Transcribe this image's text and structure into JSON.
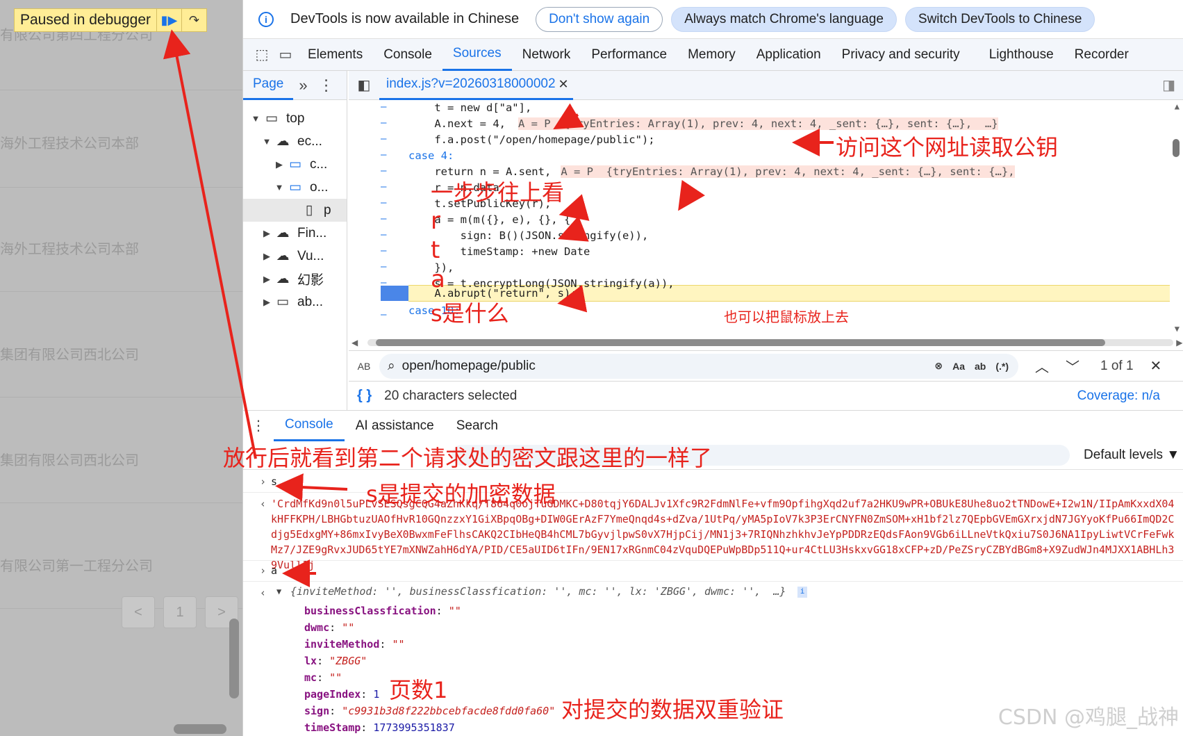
{
  "page": {
    "rows": [
      "有限公司第四工程分公司",
      "海外工程技术公司本部",
      "海外工程技术公司本部",
      "集团有限公司西北公司",
      "集团有限公司西北公司",
      "有限公司第一工程分公司"
    ],
    "pager": [
      "<",
      "1",
      ">"
    ]
  },
  "paused": {
    "label": "Paused in debugger"
  },
  "infobar": {
    "message": "DevTools is now available in Chinese",
    "btn_dont_show": "Don't show again",
    "btn_match": "Always match Chrome's language",
    "btn_switch": "Switch DevTools to Chinese"
  },
  "tabs": [
    "Elements",
    "Console",
    "Sources",
    "Network",
    "Performance",
    "Memory",
    "Application",
    "Privacy and security",
    "Lighthouse",
    "Recorder"
  ],
  "navigator": {
    "tab": "Page",
    "items": [
      {
        "label": "top"
      },
      {
        "label": "ec..."
      },
      {
        "label": "c..."
      },
      {
        "label": "o..."
      },
      {
        "label": "p"
      },
      {
        "label": "Fin..."
      },
      {
        "label": "Vu..."
      },
      {
        "label": "幻影"
      },
      {
        "label": "ab..."
      }
    ]
  },
  "editor": {
    "file_tab": "index.js?v=20260318000002",
    "find_query": "open/homepage/public",
    "find_opts": [
      "Aa",
      "ab",
      "(.*)"
    ],
    "find_count": "1 of 1",
    "status_selected": "20 characters selected",
    "coverage": "Coverage: n/a"
  },
  "code_lines": [
    {
      "text": "    t = new d[\"a\"],"
    },
    {
      "text": "    A.next = 4,"
    },
    {
      "text": "    f.a.post(\"/open/homepage/public\");"
    },
    {
      "text": "case 4:"
    },
    {
      "text": "    return n = A.sent,"
    },
    {
      "text": "    r = n.data,"
    },
    {
      "text": "    t.setPublicKey(r),"
    },
    {
      "text": "    a = m(m({}, e), {}, {"
    },
    {
      "text": "        sign: B()(JSON.stringify(e)),"
    },
    {
      "text": "        timeStamp: +new Date"
    },
    {
      "text": "    }),"
    },
    {
      "text": "    s = t.encryptLong(JSON.stringify(a)),"
    },
    {
      "text": "    A.abrupt(\"return\", s);"
    },
    {
      "text": "case 10:"
    }
  ],
  "inline_vals": {
    "next": "A = P  {tryEntries: Array(1), prev: 4, next: 4, _sent: {…}, sent: {…},  …}",
    "sent": "A = P  {tryEntries: Array(1), prev: 4, next: 4, _sent: {…}, sent: {…},"
  },
  "drawer": {
    "tabs": [
      "Console",
      "AI assistance",
      "Search"
    ],
    "levels": "Default levels ▼"
  },
  "console": {
    "in_s": "s",
    "cipher": "'CrdMfKd9n0l5uPLvSESQsgCQG4aZhKkq/T864q0ojTuGDMKC+D80tqjY6DALJv1Xfc9R2FdmNlFe+vfm9OpfihgXqd2uf7a2HKU9wPR+OBUkE8Uhe8uo2tTNDowE+I2w1N/IIpAmKxxdX04kHFFKPH/LBHGbtuzUAOfHvR10GQnzzxY1GiXBpqOBg+DIW0GErAzF7YmeQnqd4s+dZva/1UtPq/yMA5pIoV7k3P3ErCNYFN0ZmSOM+xH1bf2lz7QEpbGVEmGXrxjdN7JGYyoKfPu66ImQD2Cdjg5EdxgMY+86mxIvyBeX0BwxmFeFlhsCAKQ2CIbHeQB4hCML7bGyvjlpwS0vX7HjpCij/MN1j3+7RIQNhzhkhvJeYpPDDRzEQdsFAon9VGb6iLLneVtkQxiu7S0J6NA1IpyLiwtVCrFeFwkMz7/JZE9gRvxJUD65tYE7mXNWZahH6dYA/PID/CE5aUID6tIFn/9EN17xRGnmC04zVquDQEPuWpBDp511Q+ur4CtLU3HskxvGG18xCFP+zD/PeZSryCZBYdBGm8+X9ZudWJn4MJXX1ABHLh39Vull1j",
    "in_a": "a",
    "obj_summary": "{inviteMethod: '', businessClassfication: '', mc: '', lx: 'ZBGG', dwmc: '',  …}",
    "props": [
      {
        "k": "businessClassfication",
        "v": "\"\"",
        "t": "s"
      },
      {
        "k": "dwmc",
        "v": "\"\"",
        "t": "s"
      },
      {
        "k": "inviteMethod",
        "v": "\"\"",
        "t": "s"
      },
      {
        "k": "lx",
        "v": "\"ZBGG\"",
        "t": "s"
      },
      {
        "k": "mc",
        "v": "\"\"",
        "t": "s"
      },
      {
        "k": "pageIndex",
        "v": "1",
        "t": "n"
      },
      {
        "k": "sign",
        "v": "\"c9931b3d8f222bbcebfacde8fdd0fa60\"",
        "t": "s"
      },
      {
        "k": "timeStamp",
        "v": "1773995351837",
        "t": "n"
      }
    ]
  },
  "annotations": {
    "url_note": "访问这个网址读取公钥",
    "step_up": "一步步往上看",
    "r": "r",
    "t": "t",
    "a": "a",
    "s_what": "s是什么",
    "hover": "也可以把鼠标放上去",
    "release": "放行后就看到第二个请求处的密文跟这里的一样了",
    "s_submit": "s是提交的加密数据",
    "page1": "页数1",
    "double": "对提交的数据双重验证"
  },
  "watermark": "CSDN @鸡腿_战神",
  "colors": {
    "accent": "#1a73e8",
    "annotation": "#e8231c",
    "paused_bg": "#ffed96"
  }
}
